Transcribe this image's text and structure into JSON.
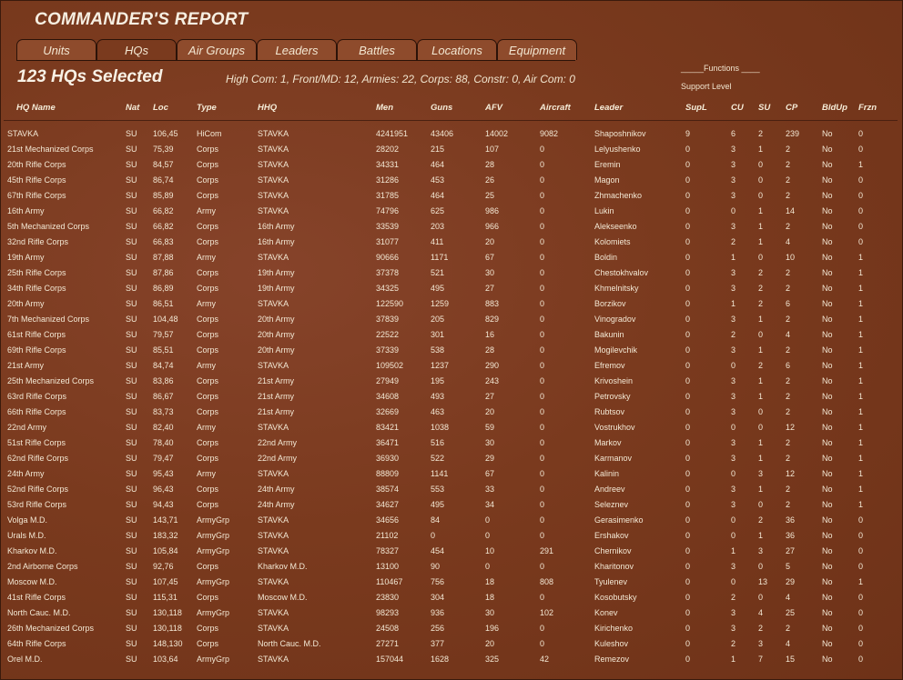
{
  "window": {
    "title": "COMMANDER'S REPORT"
  },
  "tabs": [
    {
      "label": "Units",
      "active": false
    },
    {
      "label": "HQs",
      "active": true
    },
    {
      "label": "Air Groups",
      "active": false
    },
    {
      "label": "Leaders",
      "active": false
    },
    {
      "label": "Battles",
      "active": false
    },
    {
      "label": "Locations",
      "active": false
    },
    {
      "label": "Equipment",
      "active": false
    }
  ],
  "header": {
    "selected_count": "123 HQs Selected",
    "summary": "High Com: 1,  Front/MD: 12,  Armies: 22,  Corps: 88,  Constr: 0,  Air Com: 0",
    "functions_label": "_____Functions ____",
    "support_level_label": "Support Level"
  },
  "columns": [
    "HQ Name",
    "Nat",
    "Loc",
    "Type",
    "HHQ",
    "Men",
    "Guns",
    "AFV",
    "Aircraft",
    "Leader",
    "SupL",
    "CU",
    "SU",
    "CP",
    "BldUp",
    "Frzn"
  ],
  "rows": [
    [
      "STAVKA",
      "SU",
      "106,45",
      "HiCom",
      "STAVKA",
      "4241951",
      "43406",
      "14002",
      "9082",
      "Shaposhnikov",
      "9",
      "6",
      "2",
      "239",
      "No",
      "0"
    ],
    [
      "21st Mechanized Corps",
      "SU",
      "75,39",
      "Corps",
      "STAVKA",
      "28202",
      "215",
      "107",
      "0",
      "Lelyushenko",
      "0",
      "3",
      "1",
      "2",
      "No",
      "0"
    ],
    [
      "20th Rifle Corps",
      "SU",
      "84,57",
      "Corps",
      "STAVKA",
      "34331",
      "464",
      "28",
      "0",
      "Eremin",
      "0",
      "3",
      "0",
      "2",
      "No",
      "1"
    ],
    [
      "45th Rifle Corps",
      "SU",
      "86,74",
      "Corps",
      "STAVKA",
      "31286",
      "453",
      "26",
      "0",
      "Magon",
      "0",
      "3",
      "0",
      "2",
      "No",
      "0"
    ],
    [
      "67th Rifle Corps",
      "SU",
      "85,89",
      "Corps",
      "STAVKA",
      "31785",
      "464",
      "25",
      "0",
      "Zhmachenko",
      "0",
      "3",
      "0",
      "2",
      "No",
      "0"
    ],
    [
      "16th Army",
      "SU",
      "66,82",
      "Army",
      "STAVKA",
      "74796",
      "625",
      "986",
      "0",
      "Lukin",
      "0",
      "0",
      "1",
      "14",
      "No",
      "0"
    ],
    [
      "5th Mechanized Corps",
      "SU",
      "66,82",
      "Corps",
      "16th Army",
      "33539",
      "203",
      "966",
      "0",
      "Alekseenko",
      "0",
      "3",
      "1",
      "2",
      "No",
      "0"
    ],
    [
      "32nd Rifle Corps",
      "SU",
      "66,83",
      "Corps",
      "16th Army",
      "31077",
      "411",
      "20",
      "0",
      "Kolomiets",
      "0",
      "2",
      "1",
      "4",
      "No",
      "0"
    ],
    [
      "19th Army",
      "SU",
      "87,88",
      "Army",
      "STAVKA",
      "90666",
      "1171",
      "67",
      "0",
      "Boldin",
      "0",
      "1",
      "0",
      "10",
      "No",
      "1"
    ],
    [
      "25th Rifle Corps",
      "SU",
      "87,86",
      "Corps",
      "19th Army",
      "37378",
      "521",
      "30",
      "0",
      "Chestokhvalov",
      "0",
      "3",
      "2",
      "2",
      "No",
      "1"
    ],
    [
      "34th Rifle Corps",
      "SU",
      "86,89",
      "Corps",
      "19th Army",
      "34325",
      "495",
      "27",
      "0",
      "Khmelnitsky",
      "0",
      "3",
      "2",
      "2",
      "No",
      "1"
    ],
    [
      "20th Army",
      "SU",
      "86,51",
      "Army",
      "STAVKA",
      "122590",
      "1259",
      "883",
      "0",
      "Borzikov",
      "0",
      "1",
      "2",
      "6",
      "No",
      "1"
    ],
    [
      "7th Mechanized Corps",
      "SU",
      "104,48",
      "Corps",
      "20th Army",
      "37839",
      "205",
      "829",
      "0",
      "Vinogradov",
      "0",
      "3",
      "1",
      "2",
      "No",
      "1"
    ],
    [
      "61st Rifle Corps",
      "SU",
      "79,57",
      "Corps",
      "20th Army",
      "22522",
      "301",
      "16",
      "0",
      "Bakunin",
      "0",
      "2",
      "0",
      "4",
      "No",
      "1"
    ],
    [
      "69th Rifle Corps",
      "SU",
      "85,51",
      "Corps",
      "20th Army",
      "37339",
      "538",
      "28",
      "0",
      "Mogilevchik",
      "0",
      "3",
      "1",
      "2",
      "No",
      "1"
    ],
    [
      "21st Army",
      "SU",
      "84,74",
      "Army",
      "STAVKA",
      "109502",
      "1237",
      "290",
      "0",
      "Efremov",
      "0",
      "0",
      "2",
      "6",
      "No",
      "1"
    ],
    [
      "25th Mechanized Corps",
      "SU",
      "83,86",
      "Corps",
      "21st Army",
      "27949",
      "195",
      "243",
      "0",
      "Krivoshein",
      "0",
      "3",
      "1",
      "2",
      "No",
      "1"
    ],
    [
      "63rd Rifle Corps",
      "SU",
      "86,67",
      "Corps",
      "21st Army",
      "34608",
      "493",
      "27",
      "0",
      "Petrovsky",
      "0",
      "3",
      "1",
      "2",
      "No",
      "1"
    ],
    [
      "66th Rifle Corps",
      "SU",
      "83,73",
      "Corps",
      "21st Army",
      "32669",
      "463",
      "20",
      "0",
      "Rubtsov",
      "0",
      "3",
      "0",
      "2",
      "No",
      "1"
    ],
    [
      "22nd Army",
      "SU",
      "82,40",
      "Army",
      "STAVKA",
      "83421",
      "1038",
      "59",
      "0",
      "Vostrukhov",
      "0",
      "0",
      "0",
      "12",
      "No",
      "1"
    ],
    [
      "51st Rifle Corps",
      "SU",
      "78,40",
      "Corps",
      "22nd Army",
      "36471",
      "516",
      "30",
      "0",
      "Markov",
      "0",
      "3",
      "1",
      "2",
      "No",
      "1"
    ],
    [
      "62nd Rifle Corps",
      "SU",
      "79,47",
      "Corps",
      "22nd Army",
      "36930",
      "522",
      "29",
      "0",
      "Karmanov",
      "0",
      "3",
      "1",
      "2",
      "No",
      "1"
    ],
    [
      "24th Army",
      "SU",
      "95,43",
      "Army",
      "STAVKA",
      "88809",
      "1141",
      "67",
      "0",
      "Kalinin",
      "0",
      "0",
      "3",
      "12",
      "No",
      "1"
    ],
    [
      "52nd Rifle Corps",
      "SU",
      "96,43",
      "Corps",
      "24th Army",
      "38574",
      "553",
      "33",
      "0",
      "Andreev",
      "0",
      "3",
      "1",
      "2",
      "No",
      "1"
    ],
    [
      "53rd Rifle Corps",
      "SU",
      "94,43",
      "Corps",
      "24th Army",
      "34627",
      "495",
      "34",
      "0",
      "Seleznev",
      "0",
      "3",
      "0",
      "2",
      "No",
      "1"
    ],
    [
      "Volga M.D.",
      "SU",
      "143,71",
      "ArmyGrp",
      "STAVKA",
      "34656",
      "84",
      "0",
      "0",
      "Gerasimenko",
      "0",
      "0",
      "2",
      "36",
      "No",
      "0"
    ],
    [
      "Urals M.D.",
      "SU",
      "183,32",
      "ArmyGrp",
      "STAVKA",
      "21102",
      "0",
      "0",
      "0",
      "Ershakov",
      "0",
      "0",
      "1",
      "36",
      "No",
      "0"
    ],
    [
      "Kharkov M.D.",
      "SU",
      "105,84",
      "ArmyGrp",
      "STAVKA",
      "78327",
      "454",
      "10",
      "291",
      "Chernikov",
      "0",
      "1",
      "3",
      "27",
      "No",
      "0"
    ],
    [
      "2nd Airborne Corps",
      "SU",
      "92,76",
      "Corps",
      "Kharkov M.D.",
      "13100",
      "90",
      "0",
      "0",
      "Kharitonov",
      "0",
      "3",
      "0",
      "5",
      "No",
      "0"
    ],
    [
      "Moscow M.D.",
      "SU",
      "107,45",
      "ArmyGrp",
      "STAVKA",
      "110467",
      "756",
      "18",
      "808",
      "Tyulenev",
      "0",
      "0",
      "13",
      "29",
      "No",
      "1"
    ],
    [
      "41st Rifle Corps",
      "SU",
      "115,31",
      "Corps",
      "Moscow M.D.",
      "23830",
      "304",
      "18",
      "0",
      "Kosobutsky",
      "0",
      "2",
      "0",
      "4",
      "No",
      "0"
    ],
    [
      "North Cauc. M.D.",
      "SU",
      "130,118",
      "ArmyGrp",
      "STAVKA",
      "98293",
      "936",
      "30",
      "102",
      "Konev",
      "0",
      "3",
      "4",
      "25",
      "No",
      "0"
    ],
    [
      "26th Mechanized Corps",
      "SU",
      "130,118",
      "Corps",
      "STAVKA",
      "24508",
      "256",
      "196",
      "0",
      "Kirichenko",
      "0",
      "3",
      "2",
      "2",
      "No",
      "0"
    ],
    [
      "64th Rifle Corps",
      "SU",
      "148,130",
      "Corps",
      "North Cauc. M.D.",
      "27271",
      "377",
      "20",
      "0",
      "Kuleshov",
      "0",
      "2",
      "3",
      "4",
      "No",
      "0"
    ],
    [
      "Orel M.D.",
      "SU",
      "103,64",
      "ArmyGrp",
      "STAVKA",
      "157044",
      "1628",
      "325",
      "42",
      "Remezov",
      "0",
      "1",
      "7",
      "15",
      "No",
      "0"
    ]
  ]
}
